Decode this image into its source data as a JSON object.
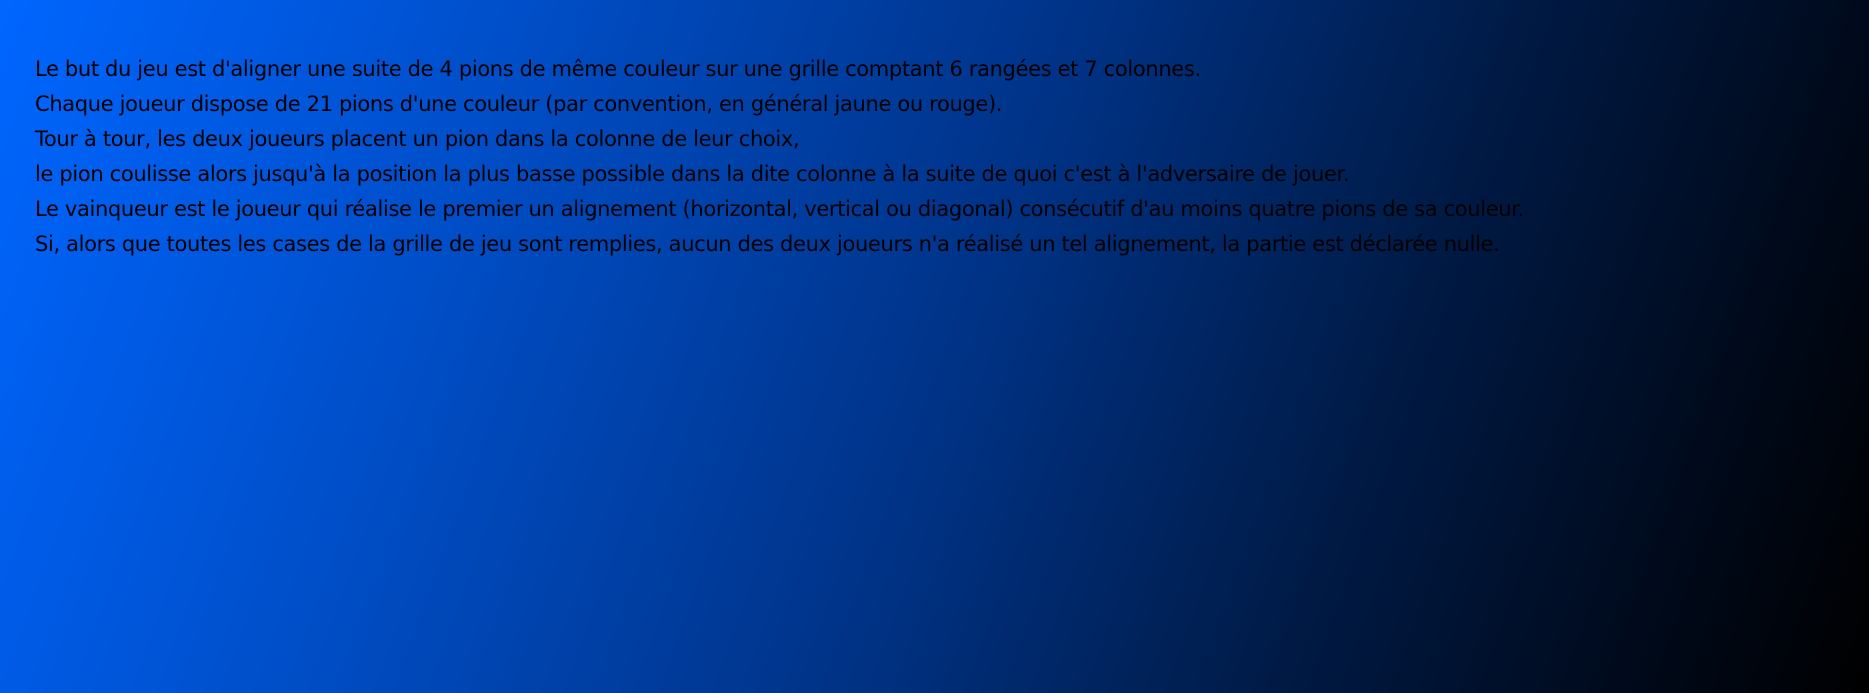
{
  "rules": {
    "lines": [
      "Le but du jeu est d'aligner une suite de 4 pions de même couleur sur une grille comptant 6 rangées et 7 colonnes.",
      "Chaque joueur dispose de 21 pions d'une couleur (par convention, en général jaune ou rouge).",
      "Tour à tour, les deux joueurs placent un pion dans la colonne de leur choix,",
      "le pion coulisse alors jusqu'à la position la plus basse possible dans la dite colonne à la suite de quoi c'est à l'adversaire de jouer.",
      "Le vainqueur est le joueur qui réalise le premier un alignement (horizontal, vertical ou diagonal) consécutif d'au moins quatre pions de sa couleur.",
      "Si, alors que toutes les cases de la grille de jeu sont remplies, aucun des deux joueurs n'a réalisé un tel alignement, la partie est déclarée nulle."
    ]
  },
  "colors": {
    "background_start": "#0066ff",
    "background_end": "#000000",
    "text": "#000000"
  }
}
